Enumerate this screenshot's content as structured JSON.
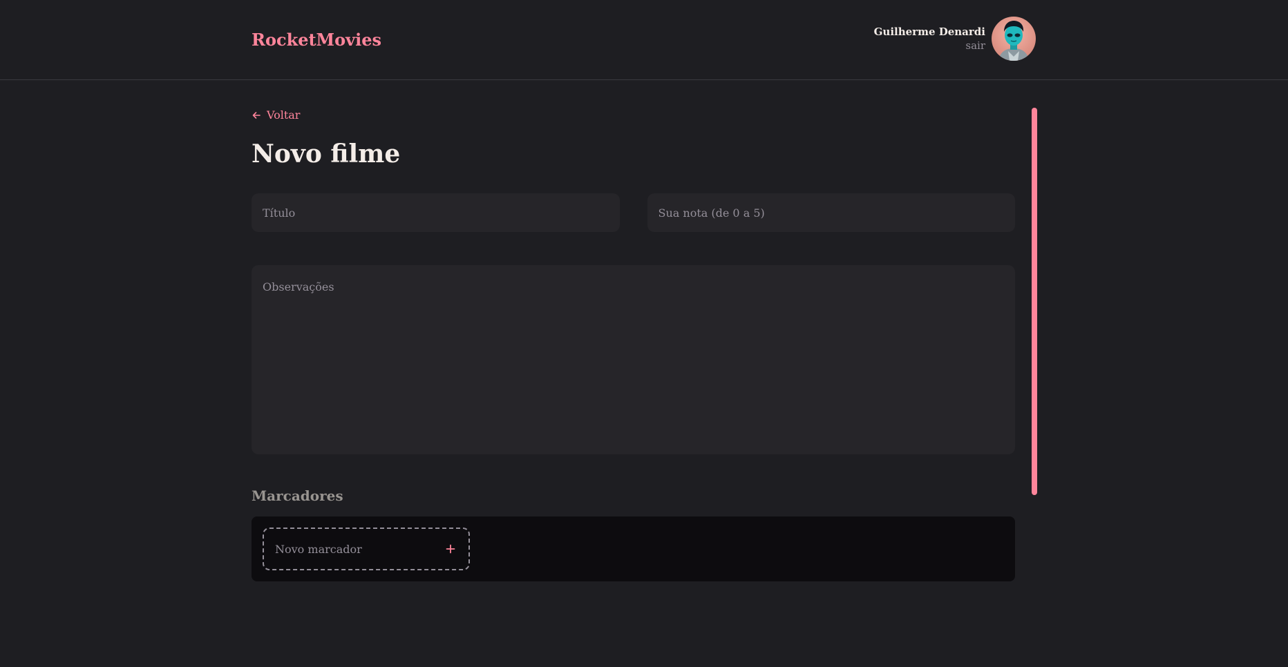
{
  "app": {
    "brand": "RocketMovies"
  },
  "header": {
    "user_name": "Guilherme Denardi",
    "logout_label": "sair",
    "avatar_icon": "user-avatar-icon"
  },
  "main": {
    "back_label": "Voltar",
    "back_icon": "arrow-left-icon",
    "title": "Novo filme",
    "title_field": {
      "placeholder": "Título",
      "value": ""
    },
    "rating_field": {
      "placeholder": "Sua nota (de 0 a 5)",
      "value": ""
    },
    "notes_field": {
      "placeholder": "Observações",
      "value": ""
    },
    "tags_section_title": "Marcadores",
    "new_tag": {
      "placeholder": "Novo marcador",
      "value": "",
      "add_icon": "plus-icon"
    }
  },
  "colors": {
    "background": "#1e1e22",
    "accent": "#ff859b",
    "input_background": "#262529",
    "tags_background": "#0d0c0f",
    "text_primary": "#f4ede8",
    "text_muted": "#948f99"
  }
}
